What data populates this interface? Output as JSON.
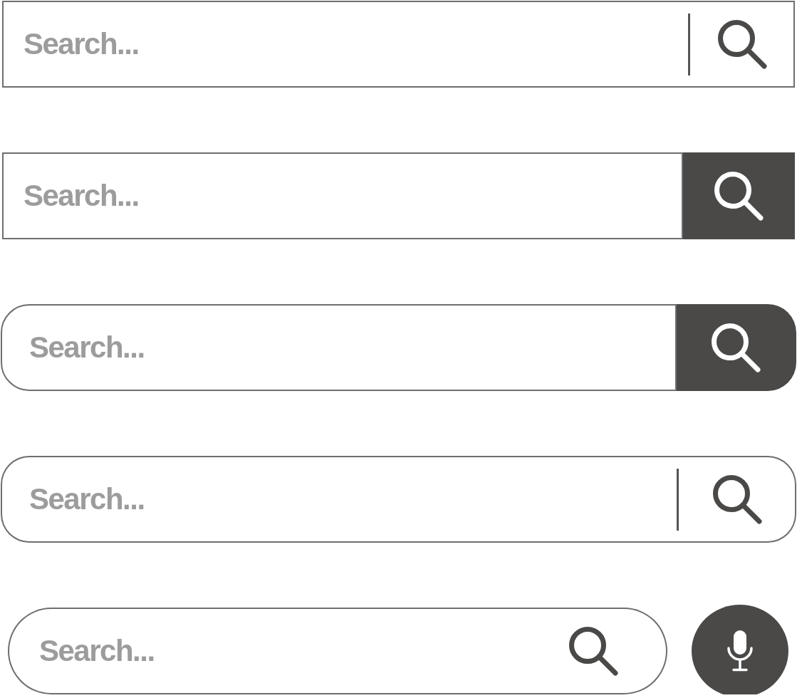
{
  "search_bars": [
    {
      "kind": "divided",
      "placeholder": "Search..."
    },
    {
      "kind": "boxed",
      "placeholder": "Search..."
    },
    {
      "kind": "capsule",
      "placeholder": "Search..."
    },
    {
      "kind": "rounded",
      "placeholder": "Search..."
    },
    {
      "kind": "pill",
      "placeholder": "Search...",
      "voice_button": true
    }
  ]
}
